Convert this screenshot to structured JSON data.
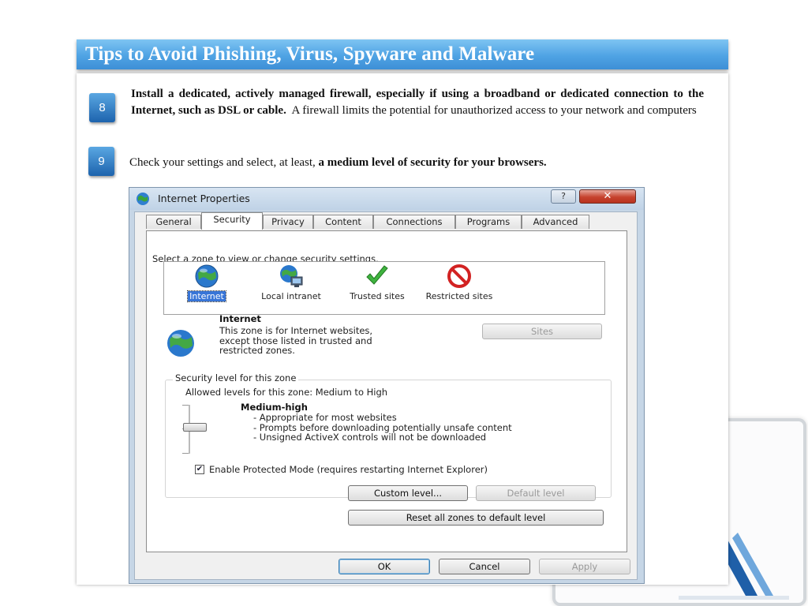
{
  "slide": {
    "title": "Tips to Avoid Phishing, Virus, Spyware and Malware"
  },
  "tips": [
    {
      "number": "8",
      "bold_text": "Install a dedicated, actively managed firewall, especially if using a broadband or dedicated connection to the Internet, such as DSL or cable.",
      "normal_text": "A firewall limits the potential for unauthorized access to your network and computers"
    },
    {
      "number": "9",
      "normal_text": "Check your settings and select, at least,",
      "bold_text": "a medium level of security for your browsers."
    }
  ],
  "dialog": {
    "title": "Internet Properties",
    "help_button": "?",
    "close_button": "✕",
    "tabs": [
      {
        "label": "General",
        "active": false
      },
      {
        "label": "Security",
        "active": true
      },
      {
        "label": "Privacy",
        "active": false
      },
      {
        "label": "Content",
        "active": false
      },
      {
        "label": "Connections",
        "active": false
      },
      {
        "label": "Programs",
        "active": false
      },
      {
        "label": "Advanced",
        "active": false
      }
    ],
    "zone_prompt": "Select a zone to view or change security settings.",
    "zones": [
      {
        "label": "Internet",
        "icon": "globe-icon",
        "selected": true
      },
      {
        "label": "Local intranet",
        "icon": "intranet-icon",
        "selected": false
      },
      {
        "label": "Trusted sites",
        "icon": "checkmark-icon",
        "selected": false
      },
      {
        "label": "Restricted sites",
        "icon": "restricted-icon",
        "selected": false
      }
    ],
    "selected_zone": {
      "title": "Internet",
      "description_lines": [
        "This zone is for Internet websites,",
        "except those listed in trusted and",
        "restricted zones."
      ]
    },
    "sites_button": "Sites",
    "security_level": {
      "legend": "Security level for this zone",
      "allowed": "Allowed levels for this zone: Medium to High",
      "level_name": "Medium-high",
      "level_points": [
        "- Appropriate for most websites",
        "- Prompts before downloading potentially unsafe content",
        "- Unsigned ActiveX controls will not be downloaded"
      ],
      "slider_level": 0.5
    },
    "protected_mode": {
      "label": "Enable Protected Mode (requires restarting Internet Explorer)",
      "checked": true
    },
    "custom_level_button": "Custom level...",
    "default_level_button": "Default level",
    "reset_button": "Reset all zones to default level",
    "ok_button": "OK",
    "cancel_button": "Cancel",
    "apply_button": "Apply"
  },
  "colors": {
    "title_bar": "#4fa3e4",
    "badge": "#2a72bb",
    "selection": "#3875d7",
    "close_button": "#c6422e"
  }
}
